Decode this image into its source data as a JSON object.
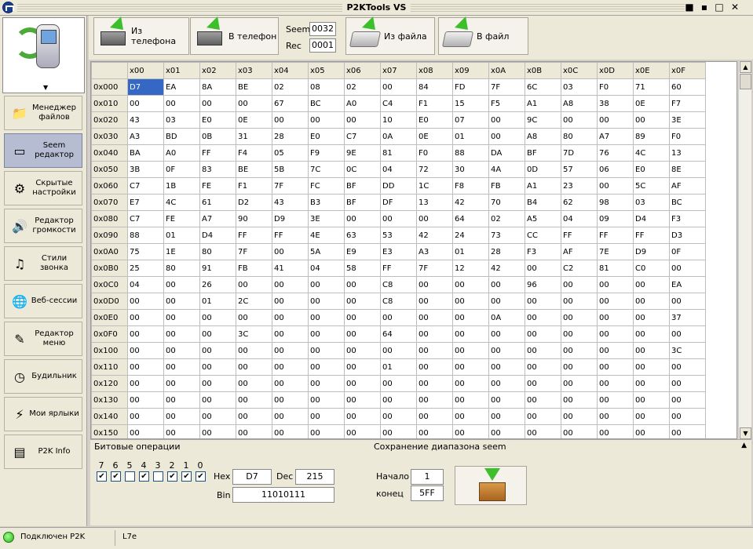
{
  "window": {
    "title": "P2KTools VS",
    "controls": [
      "■",
      "▪",
      "□",
      "✕"
    ]
  },
  "sidebar": {
    "items": [
      {
        "label": "Менеджер файлов",
        "icon": "file-manager-icon",
        "glyph": "📁"
      },
      {
        "label": "Seem редактор",
        "icon": "seem-editor-icon",
        "glyph": "▭",
        "active": true
      },
      {
        "label": "Скрытые настройки",
        "icon": "gear-icon",
        "glyph": "⚙"
      },
      {
        "label": "Редактор громкости",
        "icon": "volume-icon",
        "glyph": "🔊"
      },
      {
        "label": "Стили звонка",
        "icon": "ringtone-icon",
        "glyph": "♫"
      },
      {
        "label": "Веб-сессии",
        "icon": "globe-icon",
        "glyph": "🌐"
      },
      {
        "label": "Редактор меню",
        "icon": "menu-editor-icon",
        "glyph": "✎"
      },
      {
        "label": "Будильник",
        "icon": "clock-icon",
        "glyph": "◷"
      },
      {
        "label": "Мои ярлыки",
        "icon": "shortcuts-icon",
        "glyph": "⚡"
      },
      {
        "label": "P2K Info",
        "icon": "info-icon",
        "glyph": "▤"
      }
    ]
  },
  "toolbar": {
    "from_phone": "Из телефона",
    "to_phone": "В телефон",
    "seem_label": "Seem",
    "seem_value": "0032",
    "rec_label": "Rec",
    "rec_value": "0001",
    "from_file": "Из файла",
    "to_file": "В файл"
  },
  "grid": {
    "columns": [
      "x00",
      "x01",
      "x02",
      "x03",
      "x04",
      "x05",
      "x06",
      "x07",
      "x08",
      "x09",
      "x0A",
      "x0B",
      "x0C",
      "x0D",
      "x0E",
      "x0F"
    ],
    "selected": {
      "row": 0,
      "col": 0
    },
    "rows": [
      {
        "addr": "0x000",
        "cells": [
          "D7",
          "EA",
          "8A",
          "BE",
          "02",
          "08",
          "02",
          "00",
          "84",
          "FD",
          "7F",
          "6C",
          "03",
          "F0",
          "71",
          "60"
        ]
      },
      {
        "addr": "0x010",
        "cells": [
          "00",
          "00",
          "00",
          "00",
          "67",
          "BC",
          "A0",
          "C4",
          "F1",
          "15",
          "F5",
          "A1",
          "A8",
          "38",
          "0E",
          "F7"
        ]
      },
      {
        "addr": "0x020",
        "cells": [
          "43",
          "03",
          "E0",
          "0E",
          "00",
          "00",
          "00",
          "10",
          "E0",
          "07",
          "00",
          "9C",
          "00",
          "00",
          "00",
          "3E"
        ]
      },
      {
        "addr": "0x030",
        "cells": [
          "A3",
          "BD",
          "0B",
          "31",
          "28",
          "E0",
          "C7",
          "0A",
          "0E",
          "01",
          "00",
          "A8",
          "80",
          "A7",
          "89",
          "F0"
        ]
      },
      {
        "addr": "0x040",
        "cells": [
          "BA",
          "A0",
          "FF",
          "F4",
          "05",
          "F9",
          "9E",
          "81",
          "F0",
          "88",
          "DA",
          "BF",
          "7D",
          "76",
          "4C",
          "13"
        ]
      },
      {
        "addr": "0x050",
        "cells": [
          "3B",
          "0F",
          "83",
          "BE",
          "5B",
          "7C",
          "0C",
          "04",
          "72",
          "30",
          "4A",
          "0D",
          "57",
          "06",
          "E0",
          "8E"
        ]
      },
      {
        "addr": "0x060",
        "cells": [
          "C7",
          "1B",
          "FE",
          "F1",
          "7F",
          "FC",
          "BF",
          "DD",
          "1C",
          "F8",
          "FB",
          "A1",
          "23",
          "00",
          "5C",
          "AF"
        ]
      },
      {
        "addr": "0x070",
        "cells": [
          "E7",
          "4C",
          "61",
          "D2",
          "43",
          "B3",
          "BF",
          "DF",
          "13",
          "42",
          "70",
          "B4",
          "62",
          "98",
          "03",
          "BC"
        ]
      },
      {
        "addr": "0x080",
        "cells": [
          "C7",
          "FE",
          "A7",
          "90",
          "D9",
          "3E",
          "00",
          "00",
          "00",
          "64",
          "02",
          "A5",
          "04",
          "09",
          "D4",
          "F3"
        ]
      },
      {
        "addr": "0x090",
        "cells": [
          "88",
          "01",
          "D4",
          "FF",
          "FF",
          "4E",
          "63",
          "53",
          "42",
          "24",
          "73",
          "CC",
          "FF",
          "FF",
          "FF",
          "D3"
        ]
      },
      {
        "addr": "0x0A0",
        "cells": [
          "75",
          "1E",
          "80",
          "7F",
          "00",
          "5A",
          "E9",
          "E3",
          "A3",
          "01",
          "28",
          "F3",
          "AF",
          "7E",
          "D9",
          "0F"
        ]
      },
      {
        "addr": "0x0B0",
        "cells": [
          "25",
          "80",
          "91",
          "FB",
          "41",
          "04",
          "58",
          "FF",
          "7F",
          "12",
          "42",
          "00",
          "C2",
          "81",
          "C0",
          "00"
        ]
      },
      {
        "addr": "0x0C0",
        "cells": [
          "04",
          "00",
          "26",
          "00",
          "00",
          "00",
          "00",
          "C8",
          "00",
          "00",
          "00",
          "96",
          "00",
          "00",
          "00",
          "EA"
        ]
      },
      {
        "addr": "0x0D0",
        "cells": [
          "00",
          "00",
          "01",
          "2C",
          "00",
          "00",
          "00",
          "C8",
          "00",
          "00",
          "00",
          "00",
          "00",
          "00",
          "00",
          "00"
        ]
      },
      {
        "addr": "0x0E0",
        "cells": [
          "00",
          "00",
          "00",
          "00",
          "00",
          "00",
          "00",
          "00",
          "00",
          "00",
          "0A",
          "00",
          "00",
          "00",
          "00",
          "37"
        ]
      },
      {
        "addr": "0x0F0",
        "cells": [
          "00",
          "00",
          "00",
          "3C",
          "00",
          "00",
          "00",
          "64",
          "00",
          "00",
          "00",
          "00",
          "00",
          "00",
          "00",
          "00"
        ]
      },
      {
        "addr": "0x100",
        "cells": [
          "00",
          "00",
          "00",
          "00",
          "00",
          "00",
          "00",
          "00",
          "00",
          "00",
          "00",
          "00",
          "00",
          "00",
          "00",
          "3C"
        ]
      },
      {
        "addr": "0x110",
        "cells": [
          "00",
          "00",
          "00",
          "00",
          "00",
          "00",
          "00",
          "01",
          "00",
          "00",
          "00",
          "00",
          "00",
          "00",
          "00",
          "00"
        ]
      },
      {
        "addr": "0x120",
        "cells": [
          "00",
          "00",
          "00",
          "00",
          "00",
          "00",
          "00",
          "00",
          "00",
          "00",
          "00",
          "00",
          "00",
          "00",
          "00",
          "00"
        ]
      },
      {
        "addr": "0x130",
        "cells": [
          "00",
          "00",
          "00",
          "00",
          "00",
          "00",
          "00",
          "00",
          "00",
          "00",
          "00",
          "00",
          "00",
          "00",
          "00",
          "00"
        ]
      },
      {
        "addr": "0x140",
        "cells": [
          "00",
          "00",
          "00",
          "00",
          "00",
          "00",
          "00",
          "00",
          "00",
          "00",
          "00",
          "00",
          "00",
          "00",
          "00",
          "00"
        ]
      },
      {
        "addr": "0x150",
        "cells": [
          "00",
          "00",
          "00",
          "00",
          "00",
          "00",
          "00",
          "00",
          "00",
          "00",
          "00",
          "00",
          "00",
          "00",
          "00",
          "00"
        ]
      }
    ]
  },
  "bit_ops": {
    "title": "Битовые операции",
    "bits": [
      "7",
      "6",
      "5",
      "4",
      "3",
      "2",
      "1",
      "0"
    ],
    "checked": [
      true,
      true,
      false,
      true,
      false,
      true,
      true,
      true
    ],
    "hex_label": "Hex",
    "hex_value": "D7",
    "dec_label": "Dec",
    "dec_value": "215",
    "bin_label": "Bin",
    "bin_value": "11010111"
  },
  "range_save": {
    "title": "Сохранение диапазона seem",
    "start_label": "Начало",
    "start_value": "1",
    "end_label": "конец",
    "end_value": "5FF"
  },
  "status": {
    "connection": "Подключен P2K",
    "model": "L7e"
  }
}
